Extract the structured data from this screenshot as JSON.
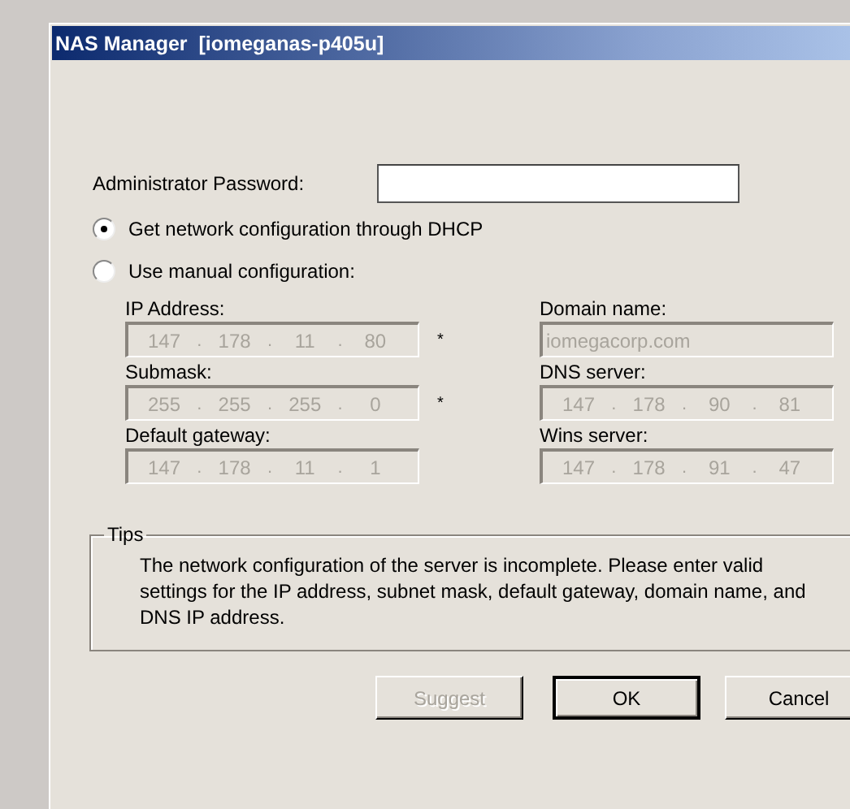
{
  "window": {
    "title": "NAS Manager  [iomeganas-p405u]"
  },
  "password": {
    "label": "Administrator Password:"
  },
  "modes": [
    {
      "label": "Get network configuration through DHCP",
      "selected": true
    },
    {
      "label": "Use manual configuration:",
      "selected": false
    }
  ],
  "ip_separator": ".",
  "fields": [
    {
      "label": "IP Address:",
      "kind": "ip",
      "octets": [
        "147",
        "178",
        "11",
        "80"
      ],
      "disabled": true,
      "required_mark": "*"
    },
    {
      "label": "Domain name:",
      "kind": "text",
      "value": "iomegacorp.com",
      "disabled": true
    },
    {
      "label": "Submask:",
      "kind": "ip",
      "octets": [
        "255",
        "255",
        "255",
        "0"
      ],
      "disabled": true,
      "required_mark": "*"
    },
    {
      "label": "DNS server:",
      "kind": "ip",
      "octets": [
        "147",
        "178",
        "90",
        "81"
      ],
      "disabled": true
    },
    {
      "label": "Default gateway:",
      "kind": "ip",
      "octets": [
        "147",
        "178",
        "11",
        "1"
      ],
      "disabled": true
    },
    {
      "label": "Wins server:",
      "kind": "ip",
      "octets": [
        "147",
        "178",
        "91",
        "47"
      ],
      "disabled": true
    }
  ],
  "tips": {
    "title": "Tips",
    "text": "The network configuration of the server is incomplete. Please enter valid settings for the IP address, subnet mask, default gateway, domain name, and DNS IP address."
  },
  "buttons": [
    {
      "label": "Suggest",
      "disabled": true,
      "default": false
    },
    {
      "label": "OK",
      "disabled": false,
      "default": true
    },
    {
      "label": "Cancel",
      "disabled": false,
      "default": false
    }
  ]
}
